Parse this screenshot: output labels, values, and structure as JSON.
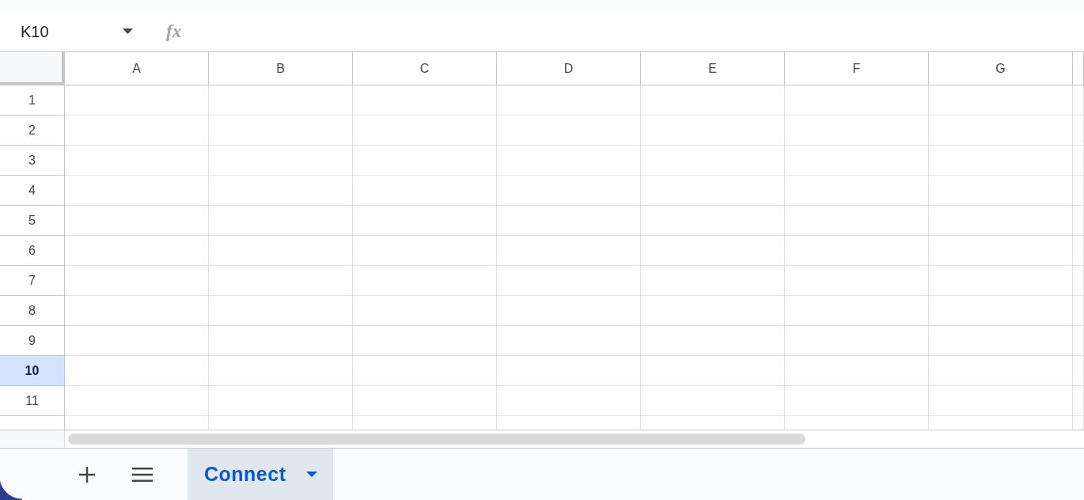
{
  "name_box": {
    "value": "K10"
  },
  "formula_bar": {
    "label": "fx"
  },
  "columns": [
    "A",
    "B",
    "C",
    "D",
    "E",
    "F",
    "G"
  ],
  "rows": [
    {
      "label": "1",
      "selected": false
    },
    {
      "label": "2",
      "selected": false
    },
    {
      "label": "3",
      "selected": false
    },
    {
      "label": "4",
      "selected": false
    },
    {
      "label": "5",
      "selected": false
    },
    {
      "label": "6",
      "selected": false
    },
    {
      "label": "7",
      "selected": false
    },
    {
      "label": "8",
      "selected": false
    },
    {
      "label": "9",
      "selected": false
    },
    {
      "label": "10",
      "selected": true
    },
    {
      "label": "11",
      "selected": false
    }
  ],
  "sheet_tabs": [
    {
      "label": "Connect",
      "selected": true
    }
  ]
}
